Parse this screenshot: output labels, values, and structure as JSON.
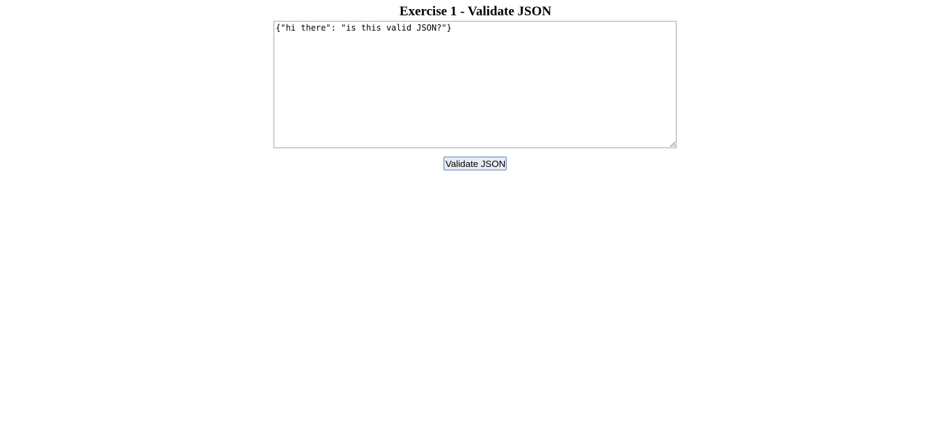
{
  "page": {
    "title": "Exercise 1 - Validate JSON"
  },
  "editor": {
    "value": "{\"hi there\": \"is this valid JSON?\"}"
  },
  "actions": {
    "validate_label": "Validate JSON"
  }
}
